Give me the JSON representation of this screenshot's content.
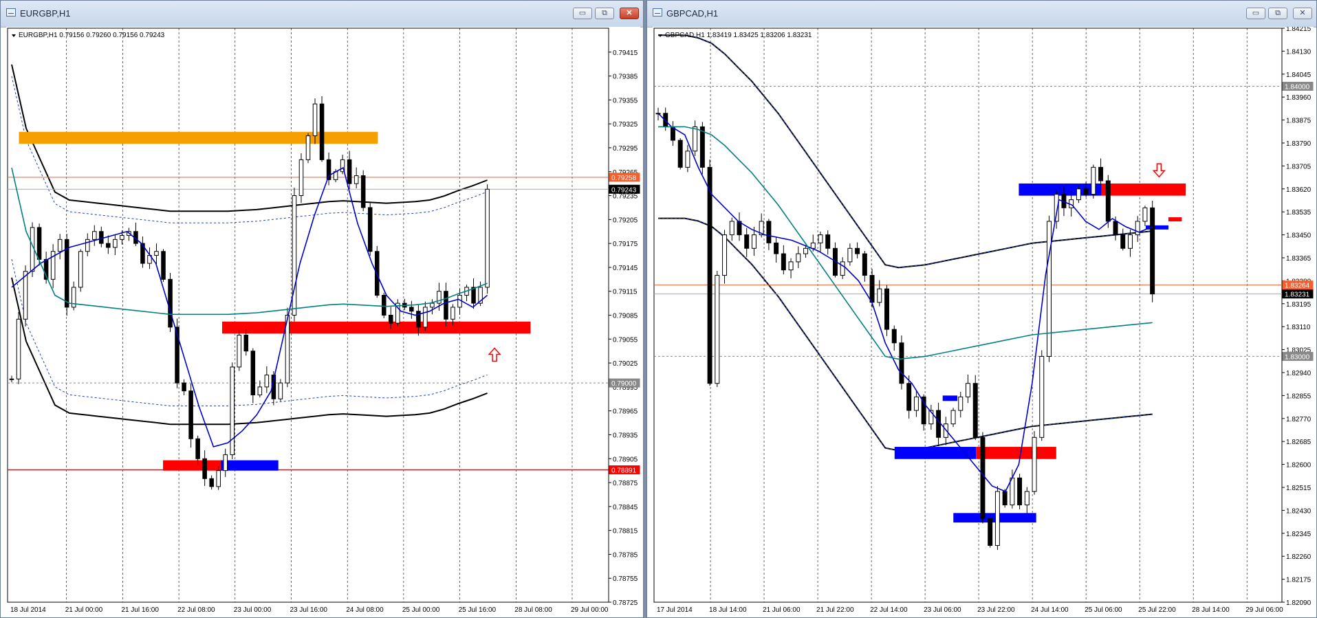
{
  "windows": [
    {
      "title": "EURGBP,H1",
      "symbol_line": "EURGBP,H1  0.79156 0.79260 0.79156 0.79243"
    },
    {
      "title": "GBPCAD,H1",
      "symbol_line": "GBPCAD,H1  1.83419 1.83425 1.83206 1.83231"
    }
  ],
  "window_buttons": {
    "minimize": "▭",
    "restore": "⧉",
    "close": "✕"
  },
  "colors": {
    "candle": "#000000",
    "fast_ma": "#0000c8",
    "slow_ma": "#008080",
    "bands": "#000000",
    "envelope": "#1e3cc8",
    "zone_orange": "#f5a000",
    "zone_red": "#ff0000",
    "zone_blue": "#0000ff",
    "current_price": "#000000",
    "highlight_price": "#f06030"
  },
  "chart_data": [
    {
      "type": "candlestick",
      "symbol": "EURGBP",
      "timeframe": "H1",
      "open": 0.79156,
      "high": 0.7926,
      "low": 0.79156,
      "close": 0.79243,
      "ylim": [
        0.78725,
        0.79445
      ],
      "y_ticks": [
        "0.79415",
        "0.79385",
        "0.79355",
        "0.79325",
        "0.79295",
        "0.79265",
        "0.79235",
        "0.79205",
        "0.79175",
        "0.79145",
        "0.79115",
        "0.79085",
        "0.79055",
        "0.79025",
        "0.78995",
        "0.78965",
        "0.78935",
        "0.78905",
        "0.78875",
        "0.78845",
        "0.78815",
        "0.78785",
        "0.78755",
        "0.78725"
      ],
      "x_ticks": [
        "18 Jul 2014",
        "21 Jul 00:00",
        "21 Jul 16:00",
        "22 Jul 08:00",
        "23 Jul 00:00",
        "23 Jul 16:00",
        "24 Jul 08:00",
        "25 Jul 00:00",
        "25 Jul 16:00",
        "28 Jul 08:00",
        "29 Jul 00:00"
      ],
      "price_tags": [
        {
          "value": 0.79258,
          "label": "0.79258",
          "style": "highlight"
        },
        {
          "value": 0.79243,
          "label": "0.79243",
          "style": "current"
        },
        {
          "value": 0.79,
          "label": "0.79000",
          "style": "level"
        },
        {
          "value": 0.78891,
          "label": "0.78891",
          "style": "red"
        }
      ],
      "zones": [
        {
          "color": "orange",
          "x": [
            0.5,
            25.4
          ],
          "y": [
            0.793,
            0.79315
          ]
        },
        {
          "color": "red",
          "x": [
            14.6,
            36.0
          ],
          "y": [
            0.79062,
            0.79077
          ]
        },
        {
          "color": "red",
          "x": [
            10.5,
            14.5
          ],
          "y": [
            0.7889,
            0.78903
          ]
        },
        {
          "color": "blue",
          "x": [
            14.5,
            18.5
          ],
          "y": [
            0.7889,
            0.78903
          ]
        }
      ],
      "arrows": [
        {
          "direction": "up",
          "x": 33.5,
          "y": 0.79035
        }
      ],
      "series": [
        {
          "name": "",
          "kind": "close",
          "values": [
            0.79005,
            0.7908,
            0.7914,
            0.79195,
            0.79155,
            0.7913,
            0.79165,
            0.7918,
            0.79095,
            0.7912,
            0.79165,
            0.7918,
            0.7919,
            0.79175,
            0.7917,
            0.7918,
            0.79185,
            0.7919,
            0.79175,
            0.7915,
            0.7916,
            0.79165,
            0.7913,
            0.7907,
            0.79,
            0.7899,
            0.7893,
            0.78905,
            0.7888,
            0.7887,
            0.7889,
            0.7891,
            0.7902,
            0.7906,
            0.7904,
            0.78985,
            0.78995,
            0.7901,
            0.7898,
            0.79,
            0.79085,
            0.79235,
            0.7928,
            0.7931,
            0.7935,
            0.7928,
            0.79255,
            0.79265,
            0.7928,
            0.7925,
            0.7926,
            0.7922,
            0.79165,
            0.7911,
            0.79085,
            0.79075,
            0.791,
            0.79095,
            0.7909,
            0.7907,
            0.79095,
            0.791,
            0.79115,
            0.7908,
            0.79095,
            0.7911,
            0.7912,
            0.791,
            0.7912,
            0.79243
          ]
        },
        {
          "name": "",
          "kind": "fast_ma",
          "values": [
            0.7912,
            0.79135,
            0.7915,
            0.7916,
            0.7917,
            0.79175,
            0.7918,
            0.79185,
            0.7919,
            0.79175,
            0.7915,
            0.7909,
            0.7903,
            0.7897,
            0.7892,
            0.78925,
            0.7894,
            0.7896,
            0.7899,
            0.7907,
            0.7915,
            0.7921,
            0.7926,
            0.7927,
            0.792,
            0.7915,
            0.7911,
            0.7909,
            0.79085,
            0.7909,
            0.791,
            0.79105,
            0.79095,
            0.7911
          ]
        },
        {
          "name": "",
          "kind": "slow_ma",
          "values": [
            0.7927,
            0.7919,
            0.7915,
            0.7911,
            0.791,
            0.79098,
            0.79096,
            0.79094,
            0.79092,
            0.7909,
            0.79088,
            0.79086,
            0.79086,
            0.79086,
            0.79086,
            0.79086,
            0.79087,
            0.79088,
            0.7909,
            0.79092,
            0.79094,
            0.79096,
            0.79098,
            0.79099,
            0.79098,
            0.79097,
            0.79096,
            0.79097,
            0.79098,
            0.791,
            0.79105,
            0.79112,
            0.79118,
            0.79125
          ]
        }
      ]
    },
    {
      "type": "candlestick",
      "symbol": "GBPCAD",
      "timeframe": "H1",
      "open": 1.83419,
      "high": 1.83425,
      "low": 1.83206,
      "close": 1.83231,
      "ylim": [
        1.8209,
        1.84215
      ],
      "y_ticks": [
        "1.84215",
        "1.84130",
        "1.84045",
        "1.83960",
        "1.83875",
        "1.83790",
        "1.83705",
        "1.83620",
        "1.83535",
        "1.83450",
        "1.83365",
        "1.83280",
        "1.83195",
        "1.83110",
        "1.83025",
        "1.82940",
        "1.82855",
        "1.82770",
        "1.82685",
        "1.82600",
        "1.82515",
        "1.82430",
        "1.82345",
        "1.82260",
        "1.82175",
        "1.82090"
      ],
      "x_ticks": [
        "17 Jul 2014",
        "18 Jul 14:00",
        "21 Jul 06:00",
        "21 Jul 22:00",
        "22 Jul 14:00",
        "23 Jul 06:00",
        "23 Jul 22:00",
        "24 Jul 14:00",
        "25 Jul 06:00",
        "25 Jul 22:00",
        "28 Jul 14:00",
        "29 Jul 06:00"
      ],
      "price_tags": [
        {
          "value": 1.84,
          "label": "1.84000",
          "style": "level"
        },
        {
          "value": 1.83264,
          "label": "1.83264",
          "style": "highlight"
        },
        {
          "value": 1.83231,
          "label": "1.83231",
          "style": "current"
        },
        {
          "value": 1.83,
          "label": "1.83000",
          "style": "level"
        }
      ],
      "zones": [
        {
          "color": "blue",
          "x": [
            27.0,
            33.2
          ],
          "y": [
            1.83595,
            1.8364
          ]
        },
        {
          "color": "red",
          "x": [
            33.2,
            39.5
          ],
          "y": [
            1.83595,
            1.8364
          ]
        },
        {
          "color": "blue",
          "x": [
            17.7,
            23.8
          ],
          "y": [
            1.8262,
            1.82665
          ]
        },
        {
          "color": "red",
          "x": [
            23.8,
            29.8
          ],
          "y": [
            1.8262,
            1.82665
          ]
        },
        {
          "color": "blue",
          "x": [
            22.1,
            28.3
          ],
          "y": [
            1.82385,
            1.8242
          ]
        },
        {
          "color": "blue",
          "x": [
            36.5,
            38.2
          ],
          "y": [
            1.8347,
            1.83485
          ]
        },
        {
          "color": "red",
          "x": [
            38.2,
            39.2
          ],
          "y": [
            1.83505,
            1.83515
          ]
        },
        {
          "color": "blue",
          "x": [
            21.3,
            22.4
          ],
          "y": [
            1.82835,
            1.82855
          ]
        }
      ],
      "arrows": [
        {
          "direction": "down",
          "x": 37.5,
          "y": 1.8369
        }
      ],
      "series": [
        {
          "name": "",
          "kind": "close",
          "values": [
            1.839,
            1.8385,
            1.838,
            1.837,
            1.8376,
            1.8385,
            1.837,
            1.829,
            1.833,
            1.8345,
            1.835,
            1.8345,
            1.834,
            1.8345,
            1.835,
            1.8342,
            1.8338,
            1.8332,
            1.8335,
            1.8338,
            1.834,
            1.8342,
            1.8345,
            1.834,
            1.833,
            1.8335,
            1.834,
            1.8338,
            1.833,
            1.832,
            1.8325,
            1.831,
            1.8305,
            1.829,
            1.828,
            1.8285,
            1.8275,
            1.828,
            1.827,
            1.8275,
            1.828,
            1.8285,
            1.829,
            1.827,
            1.824,
            1.823,
            1.825,
            1.8245,
            1.8255,
            1.8245,
            1.825,
            1.827,
            1.83,
            1.835,
            1.836,
            1.8355,
            1.8358,
            1.8362,
            1.836,
            1.837,
            1.8365,
            1.835,
            1.8345,
            1.834,
            1.8345,
            1.835,
            1.8355,
            1.83231
          ]
        },
        {
          "name": "",
          "kind": "fast_ma",
          "values": [
            1.839,
            1.8385,
            1.8382,
            1.837,
            1.836,
            1.8355,
            1.835,
            1.8347,
            1.8345,
            1.8344,
            1.8343,
            1.8341,
            1.8339,
            1.8336,
            1.8333,
            1.8328,
            1.832,
            1.8305,
            1.8295,
            1.829,
            1.8282,
            1.8276,
            1.827,
            1.8264,
            1.8258,
            1.8252,
            1.825,
            1.826,
            1.829,
            1.833,
            1.8358,
            1.8356,
            1.835,
            1.8347,
            1.8351,
            1.8348,
            1.8346,
            1.8348
          ]
        },
        {
          "name": "",
          "kind": "slow_ma",
          "values": [
            1.8385,
            1.8385,
            1.8385,
            1.8384,
            1.8382,
            1.8378,
            1.8373,
            1.8368,
            1.8362,
            1.8356,
            1.8349,
            1.8342,
            1.8335,
            1.8328,
            1.8321,
            1.8314,
            1.8307,
            1.83,
            1.8299,
            1.82995,
            1.83,
            1.8301,
            1.8302,
            1.8303,
            1.8304,
            1.8305,
            1.8306,
            1.8307,
            1.8308,
            1.83085,
            1.8309,
            1.83095,
            1.831,
            1.83105,
            1.8311,
            1.83115,
            1.8312,
            1.83125
          ]
        }
      ]
    }
  ]
}
